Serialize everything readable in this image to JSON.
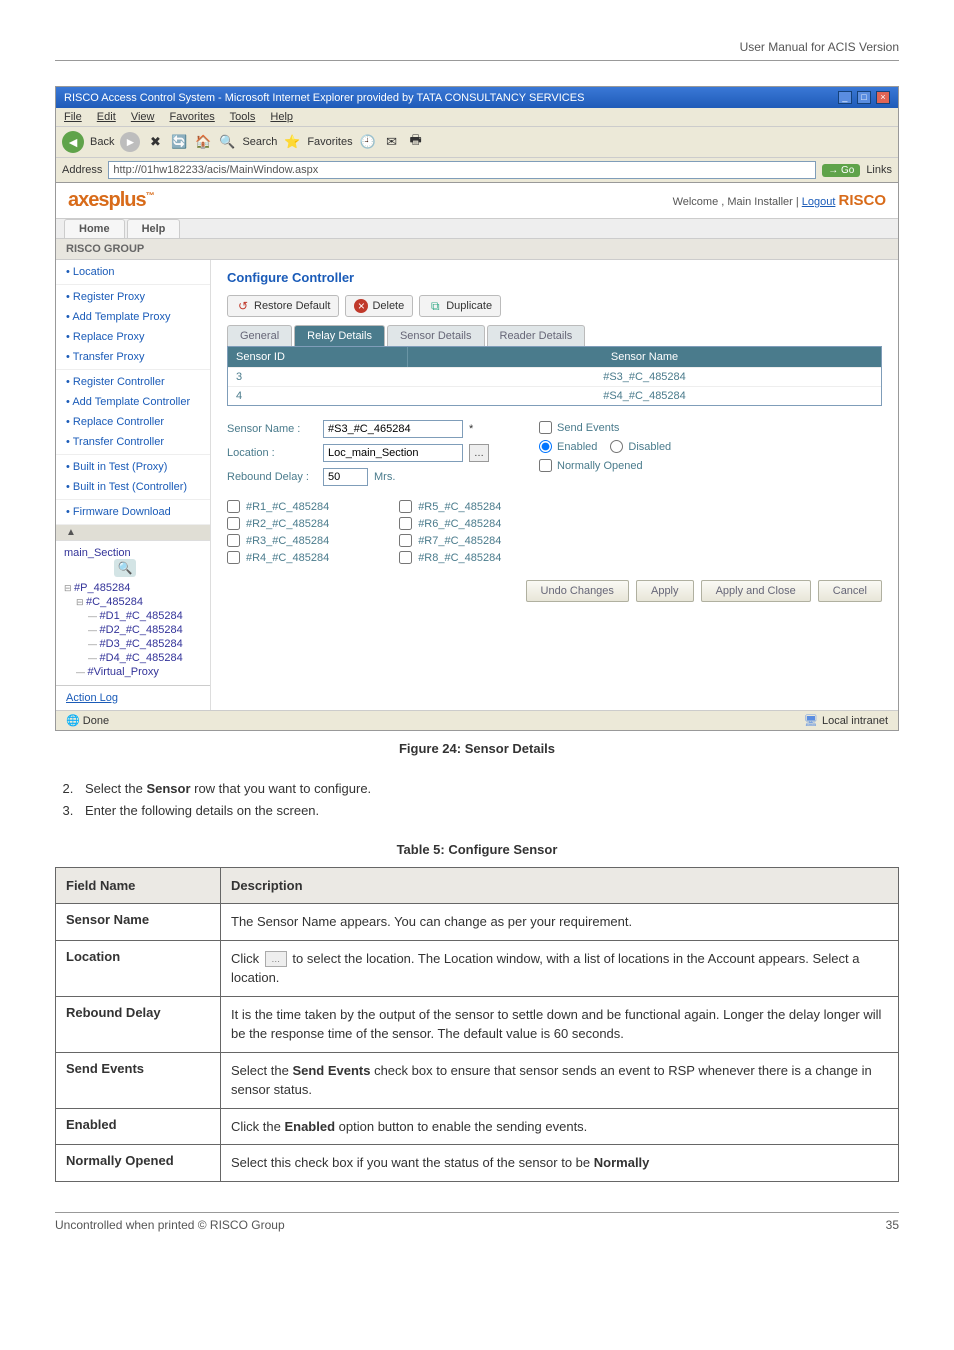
{
  "page": {
    "header_right": "User Manual for ACIS Version",
    "footer_left": "Uncontrolled when printed © RISCO Group",
    "footer_right": "35",
    "fig_caption": "Figure 24: Sensor Details",
    "steps": [
      {
        "pre": "Select the ",
        "bold": "Sensor",
        "post": " row that you want to configure."
      },
      {
        "pre": "Enter the following details on the screen.",
        "bold": "",
        "post": ""
      }
    ],
    "table_caption": "Table 5: Configure Sensor"
  },
  "screenshot": {
    "window_title": "RISCO Access Control System - Microsoft Internet Explorer provided by TATA CONSULTANCY SERVICES",
    "menubar": [
      "File",
      "Edit",
      "View",
      "Favorites",
      "Tools",
      "Help"
    ],
    "ie_back_label": "Back",
    "ie_search_label": "Search",
    "ie_fav_label": "Favorites",
    "address_label": "Address",
    "url": "http://01hw182233/acis/MainWindow.aspx",
    "go_label": "Go",
    "links_label": "Links",
    "brand": "axesplus",
    "welcome_text": "Welcome , Main Installer | ",
    "logout_label": "Logout",
    "risco_brand": "RISCO",
    "tabs": [
      "Home",
      "Help"
    ],
    "group_header": "RISCO GROUP",
    "sidebar": {
      "groups": [
        [
          "Location"
        ],
        [
          "Register Proxy",
          "Add Template Proxy",
          "Replace Proxy",
          "Transfer Proxy"
        ],
        [
          "Register Controller",
          "Add Template Controller",
          "Replace Controller",
          "Transfer Controller"
        ],
        [
          "Built in Test (Proxy)",
          "Built in Test (Controller)"
        ],
        [
          "Firmware Download"
        ]
      ],
      "tree_header": "main_Section",
      "tree": [
        {
          "label": "#P_485284",
          "indent": 0,
          "type": "bullet"
        },
        {
          "label": "#C_485284",
          "indent": 1,
          "type": "bullet"
        },
        {
          "label": "#D1_#C_485284",
          "indent": 2,
          "type": "leaf"
        },
        {
          "label": "#D2_#C_485284",
          "indent": 2,
          "type": "leaf"
        },
        {
          "label": "#D3_#C_485284",
          "indent": 2,
          "type": "leaf"
        },
        {
          "label": "#D4_#C_485284",
          "indent": 2,
          "type": "leaf"
        },
        {
          "label": "#Virtual_Proxy",
          "indent": 1,
          "type": "leaf"
        }
      ]
    },
    "action_log": "Action Log",
    "main": {
      "title": "Configure Controller",
      "toolbar": [
        "Restore Default",
        "Delete",
        "Duplicate"
      ],
      "tabstrip": [
        {
          "label": "General",
          "active": false
        },
        {
          "label": "Relay Details",
          "active": true
        },
        {
          "label": "Sensor Details",
          "active": false
        },
        {
          "label": "Reader Details",
          "active": false
        }
      ],
      "grid": {
        "headers": [
          "Sensor ID",
          "Sensor Name"
        ],
        "rows": [
          [
            "3",
            "#S3_#C_485284"
          ],
          [
            "4",
            "#S4_#C_485284"
          ]
        ]
      },
      "form": {
        "sensor_name_label": "Sensor Name :",
        "sensor_name_value": "#S3_#C_465284",
        "location_label": "Location :",
        "location_value": "Loc_main_Section",
        "rebound_label": "Rebound Delay :",
        "rebound_value": "50",
        "rebound_unit": "Mrs.",
        "send_events_label": "Send Events",
        "enabled_label": "Enabled",
        "disabled_label": "Disabled",
        "normally_opened_label": "Normally Opened"
      },
      "relays_left": [
        "#R1_#C_485284",
        "#R2_#C_485284",
        "#R3_#C_485284",
        "#R4_#C_485284"
      ],
      "relays_right": [
        "#R5_#C_485284",
        "#R6_#C_485284",
        "#R7_#C_485284",
        "#R8_#C_485284"
      ],
      "buttons": [
        "Undo Changes",
        "Apply",
        "Apply and Close",
        "Cancel"
      ]
    },
    "status_done": "Done",
    "status_zone": "Local intranet"
  },
  "table": {
    "headers": [
      "Field Name",
      "Description"
    ],
    "rows": [
      {
        "field": "Sensor Name",
        "desc_plain": "The Sensor Name appears. You can change as per your requirement."
      },
      {
        "field": "Location",
        "desc_html": "Click <span class='mini-icon' data-name='location-picker-icon' data-interactable='false'>…</span> to select the location. The Location window, with a list of locations in the Account appears. Select a location."
      },
      {
        "field": "Rebound Delay",
        "desc_plain": "It is the time taken by the output of the sensor to settle down and be functional again. Longer the delay longer will be the response time of the sensor. The default value is 60 seconds."
      },
      {
        "field": "Send Events",
        "desc_html": "Select the <strong>Send Events</strong> check box to ensure that sensor sends an event to RSP whenever there is a change in sensor status."
      },
      {
        "field": "Enabled",
        "desc_html": "Click the <strong>Enabled</strong> option button to enable the sending events."
      },
      {
        "field": "Normally Opened",
        "desc_html": "Select this check box if you want the status of the sensor to be <strong>Normally</strong>"
      }
    ]
  }
}
